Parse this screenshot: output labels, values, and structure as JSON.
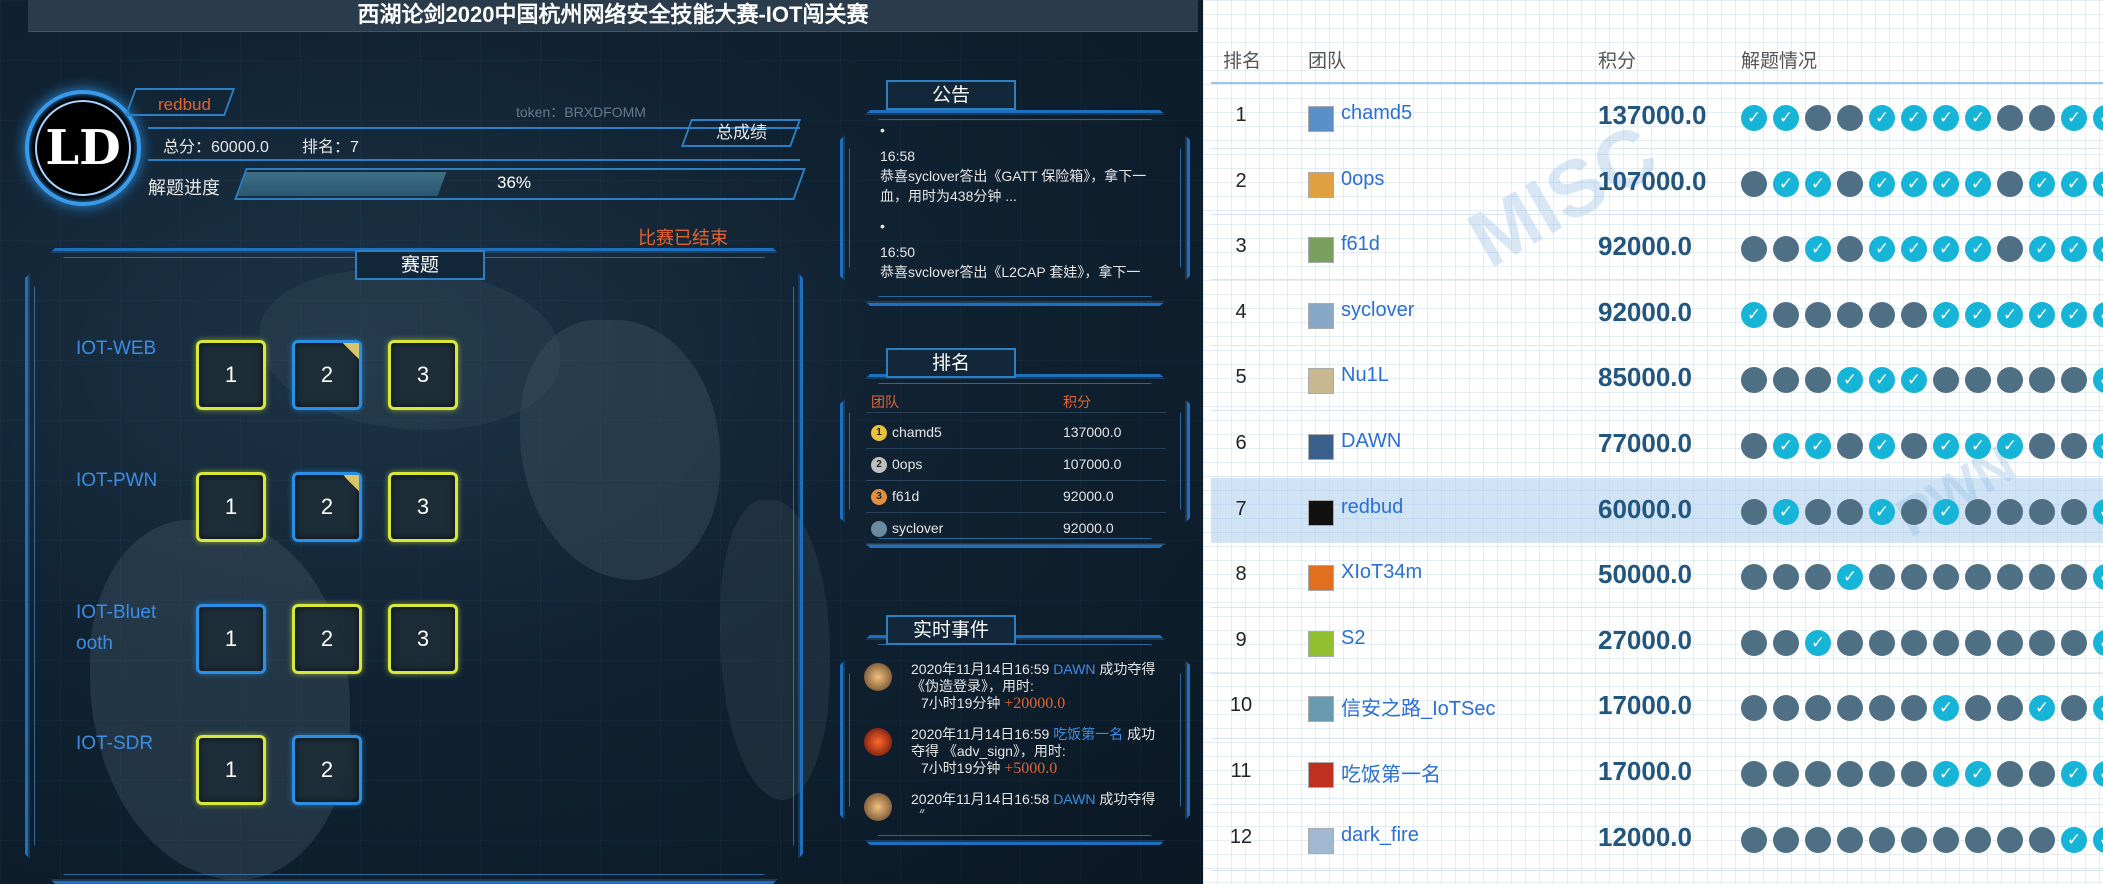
{
  "left": {
    "title": "西湖论剑2020中国杭州网络安全技能大赛-IOT闯关赛",
    "user": {
      "avatar_text": "LD",
      "name": "redbud",
      "token": "token：BRXDFOMM",
      "score": "总分：60000.0",
      "rank": "排名：7"
    },
    "total_button": "总成绩",
    "progress": {
      "label": "解题进度",
      "value": 36,
      "text": "36%"
    },
    "ended": "比赛已结束",
    "challenges": {
      "title": "赛题",
      "categories": [
        {
          "name": "IOT-WEB",
          "boxes": [
            {
              "n": "1",
              "color": "y"
            },
            {
              "n": "2",
              "color": "b",
              "corner": true
            },
            {
              "n": "3",
              "color": "y"
            }
          ]
        },
        {
          "name": "IOT-PWN",
          "boxes": [
            {
              "n": "1",
              "color": "y"
            },
            {
              "n": "2",
              "color": "b",
              "corner": true
            },
            {
              "n": "3",
              "color": "y"
            }
          ]
        },
        {
          "name": "IOT-Bluetooth",
          "display": "IOT-Bluet\nooth",
          "boxes": [
            {
              "n": "1",
              "color": "b"
            },
            {
              "n": "2",
              "color": "y"
            },
            {
              "n": "3",
              "color": "y"
            }
          ]
        },
        {
          "name": "IOT-SDR",
          "boxes": [
            {
              "n": "1",
              "color": "y"
            },
            {
              "n": "2",
              "color": "b"
            }
          ]
        }
      ]
    },
    "notice": {
      "title": "公告",
      "items": [
        {
          "bullet": "•",
          "time": "16:58",
          "text": "恭喜syclover答出《GATT 保险箱》，拿下一血，用时为438分钟 ..."
        },
        {
          "bullet": "•",
          "time": "16:50",
          "text": "恭喜svclover答出《L2CAP 套娃》，拿下一"
        }
      ]
    },
    "ranking": {
      "title": "排名",
      "headers": [
        "团队",
        "积分"
      ],
      "rows": [
        {
          "medal": "1",
          "team": "chamd5",
          "score": "137000.0"
        },
        {
          "medal": "2",
          "team": "0ops",
          "score": "107000.0"
        },
        {
          "medal": "3",
          "team": "f61d",
          "score": "92000.0"
        },
        {
          "medal": "",
          "team": "syclover",
          "score": "92000.0"
        }
      ]
    },
    "events": {
      "title": "实时事件",
      "items": [
        {
          "time": "2020年11月14日16:59",
          "team": "DAWN",
          "action": "成功夺得",
          "challenge": "《伪造登录》，用时:",
          "duration": "7小时19分钟",
          "points": "+20000.0"
        },
        {
          "time": "2020年11月14日16:59",
          "team": "吃饭第一名",
          "action": "成功夺得",
          "challenge": "《adv_sign》，用时:",
          "duration": "7小时19分钟",
          "points": "+5000.0"
        },
        {
          "time": "2020年11月14日16:58",
          "team": "DAWN",
          "action": "成功夺得",
          "challenge": "《",
          "duration": "",
          "points": ""
        }
      ]
    }
  },
  "right": {
    "headers": {
      "rank": "排名",
      "team": "团队",
      "score": "积分",
      "status": "解题情况"
    },
    "watermarks": [
      "MISC",
      "PWN"
    ],
    "rows": [
      {
        "rank": "1",
        "team": "chamd5",
        "score": "137000.0",
        "solved": [
          1,
          1,
          0,
          0,
          1,
          1,
          1,
          1,
          0,
          0,
          1,
          1
        ],
        "highlight": false
      },
      {
        "rank": "2",
        "team": "0ops",
        "score": "107000.0",
        "solved": [
          0,
          1,
          1,
          0,
          1,
          1,
          1,
          1,
          0,
          1,
          1,
          1
        ],
        "highlight": false
      },
      {
        "rank": "3",
        "team": "f61d",
        "score": "92000.0",
        "solved": [
          0,
          0,
          1,
          0,
          1,
          1,
          1,
          1,
          0,
          1,
          1,
          1
        ],
        "highlight": false
      },
      {
        "rank": "4",
        "team": "syclover",
        "score": "92000.0",
        "solved": [
          1,
          0,
          0,
          0,
          0,
          0,
          1,
          1,
          1,
          1,
          1,
          1
        ],
        "highlight": false
      },
      {
        "rank": "5",
        "team": "Nu1L",
        "score": "85000.0",
        "solved": [
          0,
          0,
          0,
          1,
          1,
          1,
          0,
          0,
          0,
          0,
          0,
          1
        ],
        "highlight": false
      },
      {
        "rank": "6",
        "team": "DAWN",
        "score": "77000.0",
        "solved": [
          0,
          1,
          1,
          0,
          1,
          0,
          1,
          1,
          1,
          0,
          0,
          1
        ],
        "highlight": false
      },
      {
        "rank": "7",
        "team": "redbud",
        "score": "60000.0",
        "solved": [
          0,
          1,
          0,
          0,
          1,
          0,
          1,
          0,
          0,
          0,
          0,
          1
        ],
        "highlight": true
      },
      {
        "rank": "8",
        "team": "XIoT34m",
        "score": "50000.0",
        "solved": [
          0,
          0,
          0,
          1,
          0,
          0,
          0,
          0,
          0,
          0,
          0,
          1
        ],
        "highlight": false
      },
      {
        "rank": "9",
        "team": "S2",
        "score": "27000.0",
        "solved": [
          0,
          0,
          1,
          0,
          0,
          0,
          0,
          0,
          0,
          0,
          0,
          1
        ],
        "highlight": false
      },
      {
        "rank": "10",
        "team": "信安之路_IoTSec",
        "score": "17000.0",
        "solved": [
          0,
          0,
          0,
          0,
          0,
          0,
          1,
          0,
          0,
          1,
          0,
          1
        ],
        "highlight": false
      },
      {
        "rank": "11",
        "team": "吃饭第一名",
        "score": "17000.0",
        "solved": [
          0,
          0,
          0,
          0,
          0,
          0,
          1,
          1,
          0,
          0,
          1,
          1
        ],
        "highlight": false
      },
      {
        "rank": "12",
        "team": "dark_fire",
        "score": "12000.0",
        "solved": [
          0,
          0,
          0,
          0,
          0,
          0,
          0,
          0,
          0,
          0,
          1,
          1
        ],
        "highlight": false
      }
    ]
  },
  "colors": {
    "accent_blue": "#2d7fc3",
    "orange": "#e5642e",
    "solved": "#16b4d6",
    "unsolved": "#4f6f85",
    "score_text": "#22567f"
  }
}
